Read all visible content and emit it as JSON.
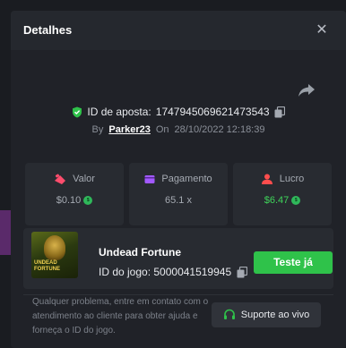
{
  "modal": {
    "title": "Detalhes"
  },
  "bet": {
    "label": "ID de aposta:",
    "id": "1747945069621473543",
    "by_label": "By",
    "user": "Parker23",
    "on_label": "On",
    "date": "28/10/2022 12:18:39"
  },
  "stats": [
    {
      "label": "Valor",
      "value": "$0.10",
      "icon": "cash-icon",
      "icon_color": "#ff4d6d"
    },
    {
      "label": "Pagamento",
      "value": "65.1 x",
      "icon": "wallet-icon",
      "icon_color": "#a259ff"
    },
    {
      "label": "Lucro",
      "value": "$6.47",
      "icon": "profit-user-icon",
      "icon_color": "#ff4d4d"
    }
  ],
  "game": {
    "name": "Undead Fortune",
    "thumb_text": "UNDEAD FORTUNE",
    "id_label": "ID do jogo: 5000041519945",
    "play_label": "Teste já"
  },
  "help": {
    "text": "Qualquer problema, entre em contato com o atendimento ao cliente para obter ajuda e forneça o ID do jogo.",
    "support_label": "Suporte ao vivo"
  },
  "colors": {
    "accent_green": "#2fc24a",
    "profit_green": "#3fd45a",
    "coin_green": "#2fb85a"
  }
}
